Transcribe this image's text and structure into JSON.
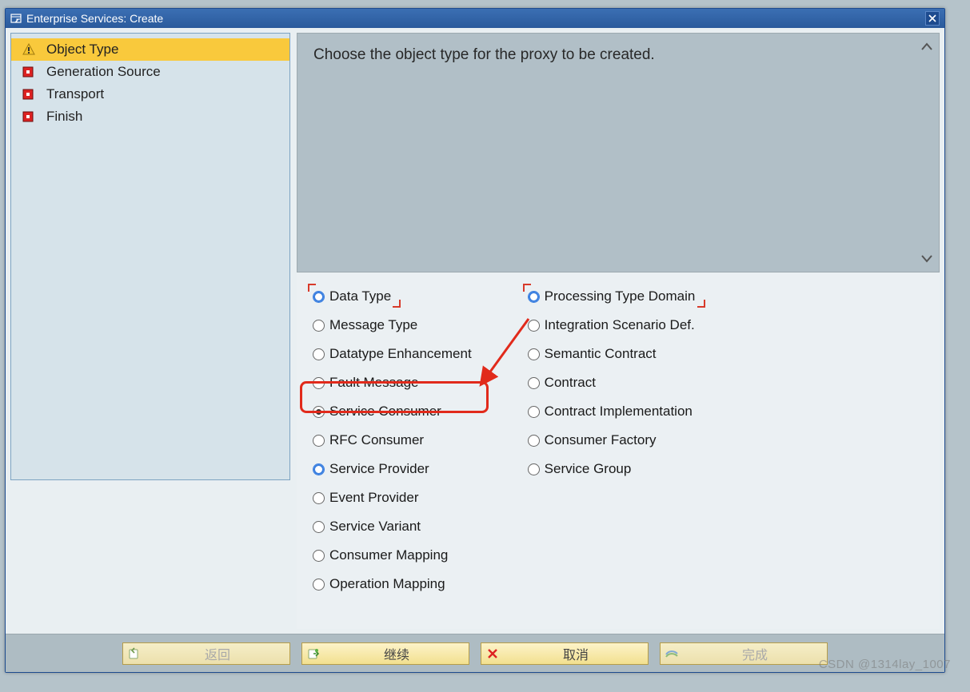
{
  "window": {
    "title": "Enterprise Services: Create"
  },
  "sidebar": {
    "items": [
      {
        "label": "Object Type",
        "icon": "warn",
        "active": true
      },
      {
        "label": "Generation Source",
        "icon": "square",
        "active": false
      },
      {
        "label": "Transport",
        "icon": "square",
        "active": false
      },
      {
        "label": "Finish",
        "icon": "square",
        "active": false
      }
    ]
  },
  "instruction": "Choose the object type for the proxy to be created.",
  "options": {
    "left": [
      {
        "label": "Data Type",
        "checked": false,
        "ring": true
      },
      {
        "label": "Message Type",
        "checked": false,
        "ring": false
      },
      {
        "label": "Datatype Enhancement",
        "checked": false,
        "ring": false
      },
      {
        "label": "Fault Message",
        "checked": false,
        "ring": false
      },
      {
        "label": "Service Consumer",
        "checked": true,
        "ring": false
      },
      {
        "label": "RFC Consumer",
        "checked": false,
        "ring": false
      },
      {
        "label": "Service Provider",
        "checked": false,
        "ring": true
      },
      {
        "label": "Event Provider",
        "checked": false,
        "ring": false
      },
      {
        "label": "Service Variant",
        "checked": false,
        "ring": false
      },
      {
        "label": "Consumer Mapping",
        "checked": false,
        "ring": false
      },
      {
        "label": "Operation Mapping",
        "checked": false,
        "ring": false
      }
    ],
    "right": [
      {
        "label": "Processing Type Domain",
        "checked": false,
        "ring": true
      },
      {
        "label": "Integration Scenario Def.",
        "checked": false,
        "ring": false
      },
      {
        "label": "Semantic Contract",
        "checked": false,
        "ring": false
      },
      {
        "label": "Contract",
        "checked": false,
        "ring": false
      },
      {
        "label": "Contract Implementation",
        "checked": false,
        "ring": false
      },
      {
        "label": "Consumer Factory",
        "checked": false,
        "ring": false
      },
      {
        "label": "Service Group",
        "checked": false,
        "ring": false
      }
    ]
  },
  "buttons": {
    "back": {
      "label": "返回",
      "enabled": false
    },
    "continue": {
      "label": "继续",
      "enabled": true
    },
    "cancel": {
      "label": "取消",
      "enabled": true
    },
    "finish": {
      "label": "完成",
      "enabled": false
    }
  },
  "watermark": "CSDN @1314lay_1007"
}
